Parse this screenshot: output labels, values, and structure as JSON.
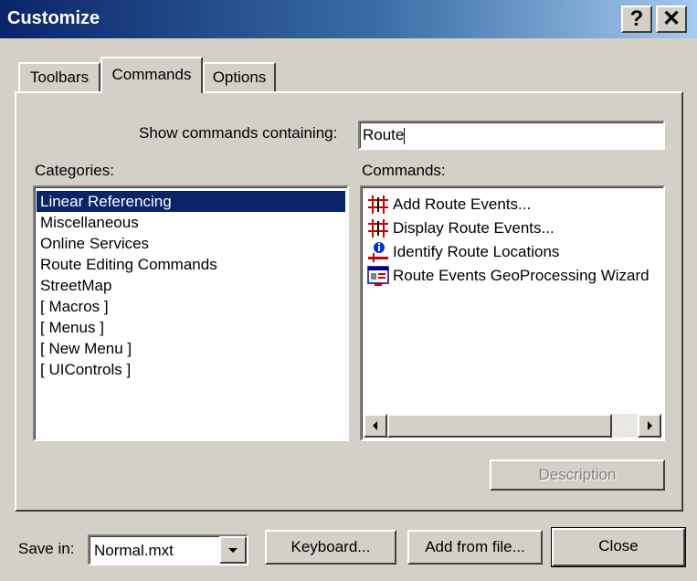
{
  "window": {
    "title": "Customize",
    "help_glyph": "?",
    "close_glyph": "✕"
  },
  "tabs": [
    {
      "label": "Toolbars"
    },
    {
      "label": "Commands"
    },
    {
      "label": "Options"
    }
  ],
  "search": {
    "label": "Show commands containing:",
    "value": "Route"
  },
  "categories": {
    "label": "Categories:",
    "items": [
      "Linear Referencing",
      "Miscellaneous",
      "Online Services",
      "Route Editing Commands",
      "StreetMap",
      "[ Macros ]",
      "[ Menus ]",
      "[ New Menu ]",
      "[ UIControls ]"
    ],
    "selected_index": 0
  },
  "commands": {
    "label": "Commands:",
    "items": [
      {
        "label": "Add Route Events...",
        "icon": "route-events-icon"
      },
      {
        "label": "Display Route Events...",
        "icon": "route-events-icon"
      },
      {
        "label": "Identify Route Locations",
        "icon": "identify-route-icon"
      },
      {
        "label": "Route Events GeoProcessing Wizard",
        "icon": "geoprocessing-wizard-icon"
      }
    ]
  },
  "description_button": "Description",
  "footer": {
    "save_in_label": "Save in:",
    "save_in_value": "Normal.mxt",
    "keyboard_button": "Keyboard...",
    "add_from_file_button": "Add from file...",
    "close_button": "Close"
  },
  "colors": {
    "selection": "#0a246a",
    "face": "#d4d0c8",
    "title_start": "#0a246a",
    "title_end": "#a6caf0"
  }
}
